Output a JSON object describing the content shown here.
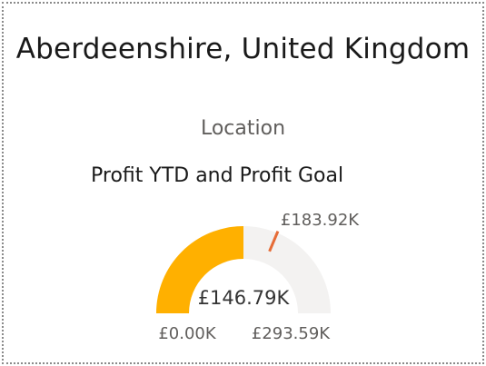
{
  "card": {
    "title": "Aberdeenshire, United Kingdom",
    "subtitle": "Location"
  },
  "gauge": {
    "title": "Profit YTD and Profit Goal",
    "value_label": "£146.79K",
    "min_label": "£0.00K",
    "max_label": "£293.59K",
    "target_label": "£183.92K",
    "value": 146.79,
    "min": 0,
    "max": 293.59,
    "target": 183.92,
    "colors": {
      "fill": "#FFB000",
      "track": "#F3F2F1",
      "target": "#E66C37"
    }
  }
}
